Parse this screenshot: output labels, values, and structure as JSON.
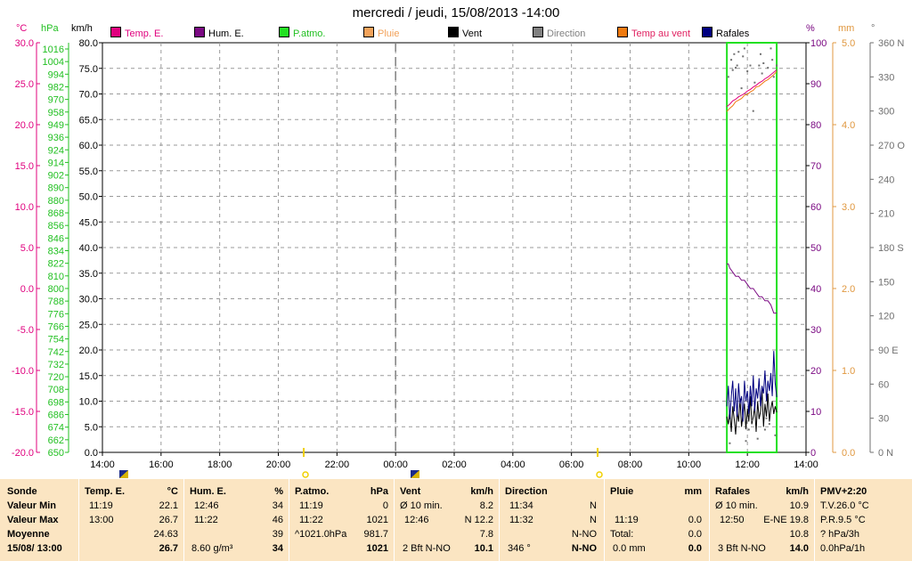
{
  "title": "mercredi / jeudi, 15/08/2013  -14:00",
  "legend": [
    {
      "label": "Temp. E.",
      "color": "#e0007e",
      "text_color": "#e0007e"
    },
    {
      "label": "Hum. E.",
      "color": "#7b0a83",
      "text_color": "#000000"
    },
    {
      "label": "P.atmo.",
      "color": "#22e022",
      "text_color": "#22c022"
    },
    {
      "label": "Pluie",
      "color": "#f2a25a",
      "text_color": "#f2a25a"
    },
    {
      "label": "Vent",
      "color": "#000000",
      "text_color": "#000000"
    },
    {
      "label": "Direction",
      "color": "#808080",
      "text_color": "#808080"
    },
    {
      "label": "Temp au vent",
      "color": "#f07a10",
      "text_color": "#e02060"
    },
    {
      "label": "Rafales",
      "color": "#000080",
      "text_color": "#000000"
    }
  ],
  "units": {
    "temp": "°C",
    "pressure": "hPa",
    "wind": "km/h",
    "humidity": "%",
    "rain": "mm",
    "direction": "°"
  },
  "colors": {
    "temp": "#e0007e",
    "pressure": "#22c022",
    "wind": "#000000",
    "humidity": "#7b0a83",
    "rain": "#e09840",
    "direction": "#707070",
    "window": "#22e022",
    "stats_bg": "#fbe5c2"
  },
  "chart_data": {
    "type": "line",
    "x_tick_labels": [
      "14:00",
      "16:00",
      "18:00",
      "20:00",
      "22:00",
      "00:00",
      "02:00",
      "04:00",
      "06:00",
      "08:00",
      "10:00",
      "12:00",
      "14:00"
    ],
    "axes": {
      "temp": {
        "ticks": [
          "30.0",
          "25.0",
          "20.0",
          "15.0",
          "10.0",
          "5.0",
          "0.0",
          "-5.0",
          "-10.0",
          "-15.0",
          "-20.0"
        ],
        "ylim": [
          -20,
          30
        ]
      },
      "pressure": {
        "ticks": [
          "1016",
          "1004",
          "994",
          "982",
          "970",
          "958",
          "949",
          "936",
          "924",
          "914",
          "902",
          "890",
          "880",
          "868",
          "856",
          "846",
          "834",
          "822",
          "810",
          "800",
          "788",
          "776",
          "766",
          "754",
          "742",
          "732",
          "720",
          "708",
          "698",
          "686",
          "674",
          "662",
          "650"
        ]
      },
      "wind": {
        "ticks": [
          "80.0",
          "75.0",
          "70.0",
          "65.0",
          "60.0",
          "55.0",
          "50.0",
          "45.0",
          "40.0",
          "35.0",
          "30.0",
          "25.0",
          "20.0",
          "15.0",
          "10.0",
          "5.0",
          "0.0"
        ],
        "ylim": [
          0,
          80
        ]
      },
      "humidity": {
        "ticks": [
          "100",
          "90",
          "80",
          "70",
          "60",
          "50",
          "40",
          "30",
          "20",
          "10",
          "0"
        ],
        "ylim": [
          0,
          100
        ]
      },
      "rain": {
        "ticks": [
          "5.0",
          "4.0",
          "3.0",
          "2.0",
          "1.0",
          "0.0"
        ],
        "ylim": [
          0,
          5
        ]
      },
      "direction": {
        "ticks": [
          "360 N",
          "330",
          "300",
          "270 O",
          "240",
          "210",
          "180 S",
          "150",
          "120",
          "90 E",
          "60",
          "30",
          "0 N"
        ],
        "ylim": [
          0,
          360
        ]
      }
    },
    "data_window": {
      "x_start_hours": 21.3,
      "x_end_hours": 23.0
    },
    "series": [
      {
        "name": "Temp. E.",
        "axis": "temp",
        "x_hours": [
          21.3,
          21.4,
          21.5,
          21.6,
          21.7,
          21.8,
          21.9,
          22.0,
          22.1,
          22.2,
          22.3,
          22.4,
          22.5,
          22.6,
          22.7,
          22.8,
          22.9,
          23.0
        ],
        "values": [
          22.2,
          22.5,
          22.9,
          23.1,
          23.4,
          23.6,
          23.8,
          24.1,
          24.3,
          24.6,
          24.8,
          25.1,
          25.3,
          25.6,
          25.8,
          26.1,
          26.4,
          26.7
        ]
      },
      {
        "name": "Temp au vent",
        "axis": "temp",
        "x_hours": [
          21.3,
          21.4,
          21.5,
          21.6,
          21.7,
          21.8,
          21.9,
          22.0,
          22.1,
          22.2,
          22.3,
          22.4,
          22.5,
          22.6,
          22.7,
          22.8,
          22.9,
          23.0
        ],
        "values": [
          21.6,
          22.0,
          22.3,
          22.8,
          23.0,
          23.2,
          23.6,
          23.7,
          24.0,
          24.2,
          24.6,
          24.7,
          25.0,
          25.3,
          25.5,
          25.8,
          26.1,
          26.5
        ]
      },
      {
        "name": "Hum. E.",
        "axis": "humidity",
        "x_hours": [
          21.3,
          21.35,
          21.4,
          21.5,
          21.6,
          21.7,
          21.8,
          21.9,
          22.0,
          22.1,
          22.2,
          22.3,
          22.4,
          22.5,
          22.6,
          22.7,
          22.8,
          22.9,
          23.0
        ],
        "values": [
          46,
          46,
          45,
          44,
          43,
          43,
          42,
          42,
          41,
          40,
          40,
          39,
          38,
          38,
          37,
          37,
          36,
          34,
          34
        ]
      },
      {
        "name": "Vent",
        "axis": "wind",
        "x_hours": [
          21.3,
          21.35,
          21.4,
          21.45,
          21.5,
          21.55,
          21.6,
          21.65,
          21.7,
          21.75,
          21.8,
          21.85,
          21.9,
          21.95,
          22.0,
          22.05,
          22.1,
          22.15,
          22.2,
          22.25,
          22.3,
          22.35,
          22.4,
          22.45,
          22.5,
          22.55,
          22.6,
          22.65,
          22.7,
          22.75,
          22.8,
          22.85,
          22.9,
          22.95,
          23.0
        ],
        "values": [
          7.0,
          5.5,
          8.2,
          4.0,
          9.0,
          6.5,
          3.5,
          8.0,
          6.0,
          10.5,
          5.0,
          7.5,
          9.5,
          4.5,
          8.5,
          6.0,
          11.0,
          5.5,
          7.0,
          9.0,
          4.0,
          10.0,
          6.5,
          8.0,
          12.2,
          5.0,
          9.5,
          7.0,
          11.5,
          6.0,
          8.5,
          10.0,
          7.5,
          9.0,
          7.8
        ]
      },
      {
        "name": "Rafales",
        "axis": "wind",
        "x_hours": [
          21.3,
          21.35,
          21.4,
          21.45,
          21.5,
          21.55,
          21.6,
          21.65,
          21.7,
          21.75,
          21.8,
          21.85,
          21.9,
          21.95,
          22.0,
          22.05,
          22.1,
          22.15,
          22.2,
          22.25,
          22.3,
          22.35,
          22.4,
          22.45,
          22.5,
          22.55,
          22.6,
          22.65,
          22.7,
          22.75,
          22.8,
          22.85,
          22.9,
          22.95,
          23.0
        ],
        "values": [
          9.0,
          13.0,
          6.5,
          11.0,
          14.0,
          8.0,
          12.5,
          7.0,
          13.5,
          9.5,
          11.0,
          6.0,
          14.0,
          10.0,
          12.0,
          7.5,
          13.0,
          9.0,
          15.0,
          8.0,
          12.5,
          10.5,
          14.5,
          9.0,
          13.0,
          11.5,
          16.0,
          10.0,
          14.0,
          12.0,
          15.5,
          11.0,
          19.8,
          13.5,
          10.8
        ]
      },
      {
        "name": "Direction",
        "axis": "direction",
        "type": "scatter",
        "x_hours": [
          21.35,
          21.45,
          21.55,
          21.6,
          21.7,
          21.8,
          21.85,
          21.95,
          22.0,
          22.1,
          22.2,
          22.25,
          22.35,
          22.45,
          22.55,
          22.6,
          22.7,
          22.8,
          22.9,
          22.95,
          21.4,
          21.65,
          21.9,
          22.15,
          22.4,
          22.65,
          22.85,
          21.5,
          22.05,
          22.5,
          22.75,
          23.0
        ],
        "values": [
          330,
          345,
          350,
          338,
          352,
          320,
          348,
          10,
          335,
          340,
          300,
          325,
          12,
          350,
          342,
          20,
          338,
          355,
          330,
          15,
          8,
          340,
          355,
          28,
          340,
          30,
          345,
          336,
          20,
          333,
          25,
          340
        ]
      }
    ]
  },
  "stats": {
    "headers": {
      "sonde": "Sonde",
      "temp": "Temp. E.",
      "temp_unit": "°C",
      "hum": "Hum. E.",
      "hum_unit": "%",
      "patmo": "P.atmo.",
      "patmo_unit": "hPa",
      "vent": "Vent",
      "vent_unit": "km/h",
      "direction": "Direction",
      "pluie": "Pluie",
      "pluie_unit": "mm",
      "rafales": "Rafales",
      "rafales_unit": "km/h",
      "pmv": "PMV+2:20"
    },
    "row_labels": [
      "Valeur Min",
      "Valeur Max",
      "Moyenne",
      "15/08/ 13:00"
    ],
    "temp": {
      "min_time": "11:19",
      "min_val": "22.1",
      "max_time": "13:00",
      "max_val": "26.7",
      "avg": "24.63",
      "current": "26.7"
    },
    "hum": {
      "min_time": "12:46",
      "min_val": "34",
      "max_time": "11:22",
      "max_val": "46",
      "avg": "39",
      "extra": "8.60 g/m³",
      "current": "34"
    },
    "patmo": {
      "min_time": "11:19",
      "min_val": "0",
      "max_time": "11:22",
      "max_val": "1021",
      "avg_label": "^1021.0hPa",
      "avg": "981.7",
      "current": "1021"
    },
    "vent": {
      "row1_label": "Ø 10 min.",
      "row1_val": "8.2",
      "max_time": "12:46",
      "max_val": "N 12.2",
      "avg": "7.8",
      "beaufort": "2 Bft N-NO",
      "current": "10.1"
    },
    "direction": {
      "min_time": "11:34",
      "min_val": "N",
      "max_time": "11:32",
      "max_val": "N",
      "avg": "N-NO",
      "deg": "346 °",
      "current": "N-NO"
    },
    "pluie": {
      "max_time": "11:19",
      "max_val": "0.0",
      "total_label": "Total:",
      "total": "0.0",
      "mm_label": "0.0 mm",
      "current": "0.0"
    },
    "rafales": {
      "row1_label": "Ø 10 min.",
      "row1_val": "10.9",
      "max_time": "12:50",
      "max_val": "E-NE 19.8",
      "avg": "10.8",
      "beaufort": "3 Bft N-NO",
      "current": "14.0"
    },
    "pmv": {
      "line1": "T.V.26.0 °C",
      "line2": "P.R.9.5 °C",
      "line3": "? hPa/3h",
      "line4": "0.0hPa/1h"
    }
  }
}
